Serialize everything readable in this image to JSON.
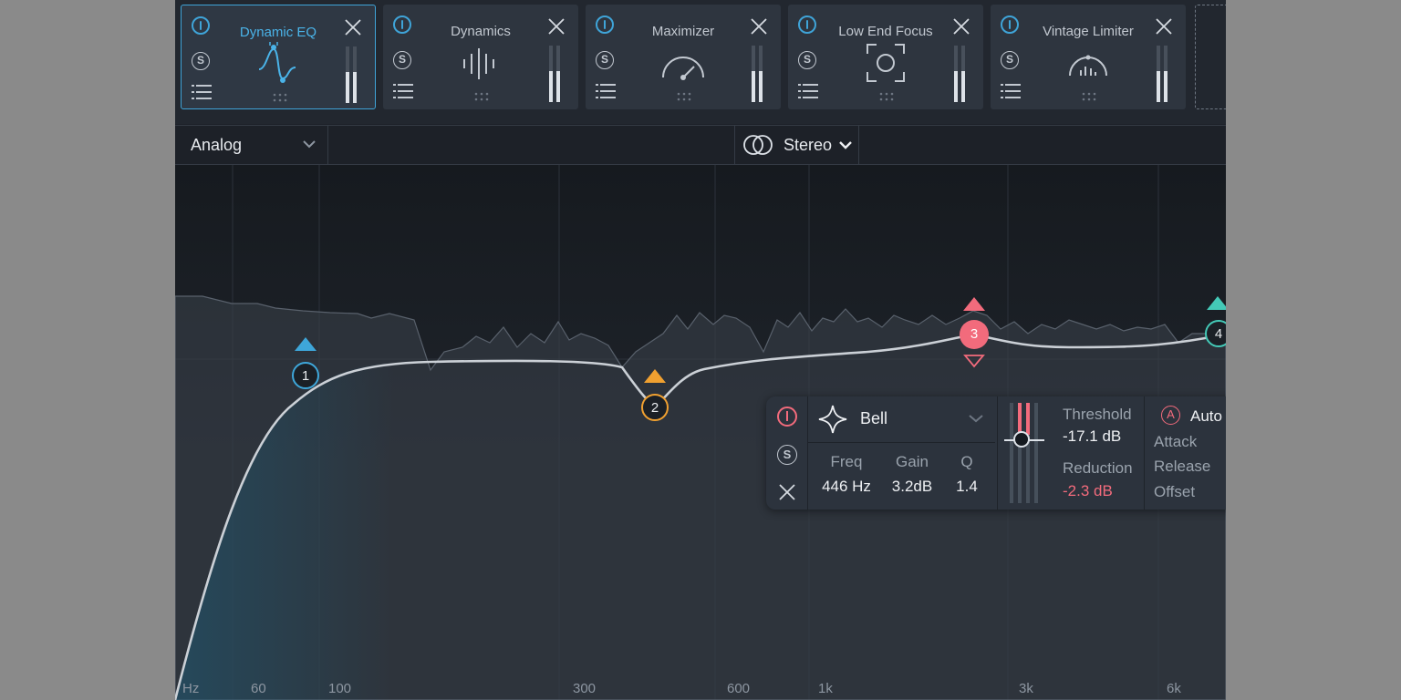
{
  "modules": [
    {
      "title": "Dynamic EQ",
      "icon": "dynamic-eq-icon",
      "active": true
    },
    {
      "title": "Dynamics",
      "icon": "dynamics-icon",
      "active": false
    },
    {
      "title": "Maximizer",
      "icon": "maximizer-icon",
      "active": false
    },
    {
      "title": "Low End Focus",
      "icon": "low-end-focus-icon",
      "active": false
    },
    {
      "title": "Vintage Limiter",
      "icon": "vintage-limiter-icon",
      "active": false
    }
  ],
  "module_controls": {
    "solo": "S"
  },
  "toolbar": {
    "mode": "Analog",
    "channel": "Stereo"
  },
  "freq_axis": [
    "Hz",
    "60",
    "100",
    "300",
    "600",
    "1k",
    "3k",
    "6k"
  ],
  "nodes": [
    {
      "label": "1",
      "color": "#3ea6d9"
    },
    {
      "label": "2",
      "color": "#f0a030"
    },
    {
      "label": "3",
      "color": "#f26b7c"
    },
    {
      "label": "4",
      "color": "#44c9b7"
    }
  ],
  "band_panel": {
    "solo": "S",
    "shape": "Bell",
    "freq_label": "Freq",
    "freq_value": "446 Hz",
    "gain_label": "Gain",
    "gain_value": "3.2dB",
    "q_label": "Q",
    "q_value": "1.4",
    "threshold_label": "Threshold",
    "threshold_value": "-17.1 dB",
    "reduction_label": "Reduction",
    "reduction_value": "-2.3 dB",
    "auto_icon": "A",
    "auto_label": "Auto",
    "attack_label": "Attack",
    "release_label": "Release",
    "offset_label": "Offset"
  },
  "colors": {
    "accent": "#3fa4d8",
    "band3": "#f26b7c",
    "background": "#1d2128"
  }
}
